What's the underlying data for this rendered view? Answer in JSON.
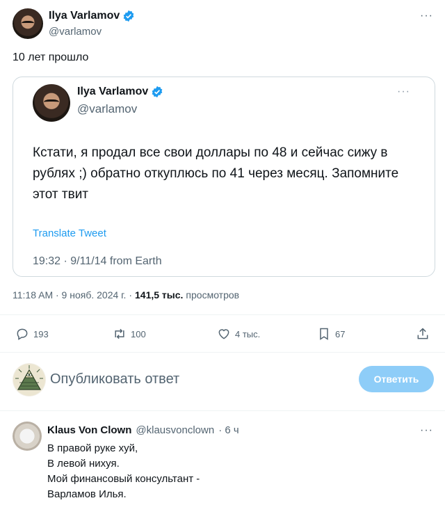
{
  "tweet": {
    "author_name": "Ilya Varlamov",
    "author_handle": "@varlamov",
    "text": "10 лет прошло",
    "meta": {
      "time": "11:18 AM · 9 нояб. 2024 г. ·",
      "views_count": "141,5 тыс.",
      "views_label": "просмотров"
    },
    "actions": {
      "replies": "193",
      "retweets": "100",
      "likes": "4 тыс.",
      "bookmarks": "67"
    }
  },
  "quote": {
    "author_name": "Ilya Varlamov",
    "author_handle": "@varlamov",
    "text": "Кстати, я продал все свои доллары по 48 и сейчас сижу в рублях ;) обратно откуплюсь по 41 через месяц. Запомните этот твит",
    "translate": "Translate Tweet",
    "timestamp": "19:32 · 9/11/14 from Earth"
  },
  "reply_box": {
    "placeholder": "Опубликовать ответ",
    "button": "Ответить"
  },
  "comment": {
    "author_name": "Klaus Von Clown",
    "author_handle": "@klausvonclown",
    "time": "· 6 ч",
    "lines": [
      "В правой руке хуй,",
      "В левой нихуя.",
      "Мой финансовый консультант -",
      "Варламов Илья."
    ]
  },
  "colors": {
    "accent": "#1d9bf0",
    "verified": "#1d9bf0",
    "button_disabled": "#8ecdf8"
  },
  "icons": [
    "verified-badge-icon",
    "more-icon",
    "reply-icon",
    "retweet-icon",
    "like-icon",
    "bookmark-icon",
    "share-icon"
  ]
}
